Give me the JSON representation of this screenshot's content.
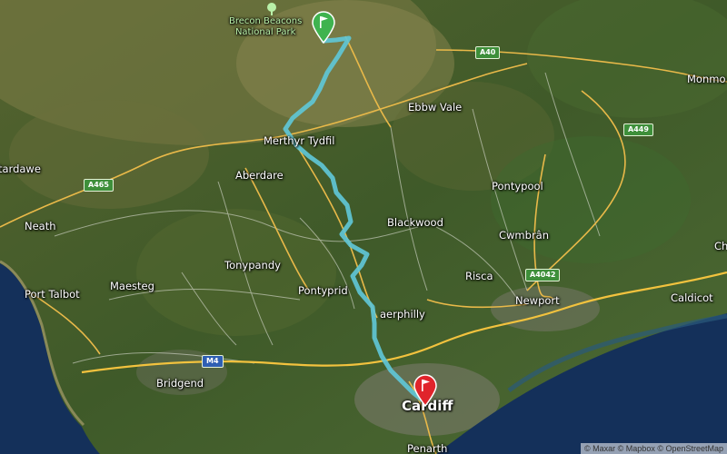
{
  "map": {
    "park_label_line1": "Brecon Beacons",
    "park_label_line2": "National Park",
    "places": {
      "merthyr": "Merthyr Tydfil",
      "ebbw": "Ebbw Vale",
      "monmouth": "Monmo",
      "tardawe": "tardawe",
      "aberdare": "Aberdare",
      "pontypool": "Pontypool",
      "blackwood": "Blackwood",
      "cwmbran": "Cwmbrân",
      "neath": "Neath",
      "tonypandy": "Tonypandy",
      "risca": "Risca",
      "ch": "Ch",
      "porttalbot": "Port Talbot",
      "maesteg": "Maesteg",
      "pontypridd": "Pontyprid",
      "newport": "Newport",
      "caldicot": "Caldicot",
      "caerphilly": "aerphilly",
      "bridgend": "Bridgend",
      "cardiff": "Cardiff",
      "penarth": "Penarth"
    },
    "roads": {
      "a40": "A40",
      "a449": "A449",
      "a465": "A465",
      "a4042": "A4042",
      "m4": "M4"
    },
    "attribution": "© Maxar © Mapbox © OpenStreetMap",
    "colors": {
      "route": "#5fc6d6",
      "start_pin": "#3fb34f",
      "end_pin": "#e0242b",
      "sea": "#14305a",
      "road": "#e9b949"
    },
    "markers": {
      "start_icon": "flag-icon",
      "end_icon": "flag-icon"
    }
  }
}
